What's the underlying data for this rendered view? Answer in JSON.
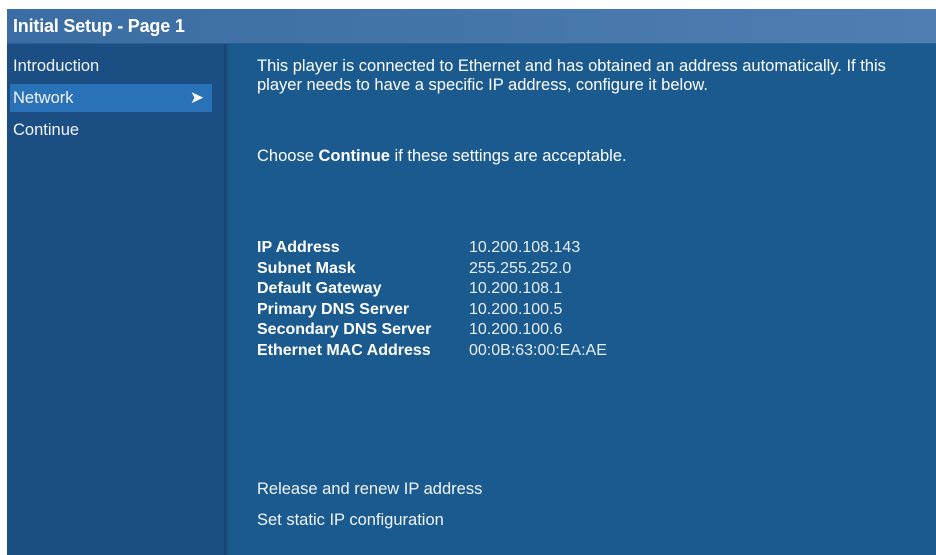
{
  "window": {
    "title": "Initial Setup - Page 1"
  },
  "sidebar": {
    "items": [
      {
        "label": "Introduction",
        "selected": false
      },
      {
        "label": "Network",
        "selected": true,
        "icon": "chevron-right-icon"
      },
      {
        "label": "Continue",
        "selected": false
      }
    ]
  },
  "main": {
    "intro_text": "This player is connected to Ethernet and has obtained an address automatically. If this player needs to have a specific IP address, configure it below.",
    "prompt_prefix": "Choose ",
    "prompt_bold": "Continue",
    "prompt_suffix": " if these settings are acceptable.",
    "network_info": [
      {
        "label": "IP Address",
        "value": "10.200.108.143"
      },
      {
        "label": "Subnet Mask",
        "value": "255.255.252.0"
      },
      {
        "label": "Default Gateway",
        "value": "10.200.108.1"
      },
      {
        "label": "Primary DNS Server",
        "value": "10.200.100.5"
      },
      {
        "label": "Secondary DNS Server",
        "value": "10.200.100.6"
      },
      {
        "label": "Ethernet MAC Address",
        "value": "00:0B:63:00:EA:AE"
      }
    ],
    "actions": [
      {
        "label": "Release and renew IP address"
      },
      {
        "label": "Set static IP configuration"
      }
    ]
  },
  "colors": {
    "background": "#1a5a8e",
    "sidebar": "#1b4f83",
    "titlebar": "#4a7bb0",
    "selection": "#2a72b8",
    "text": "#ffffff"
  }
}
